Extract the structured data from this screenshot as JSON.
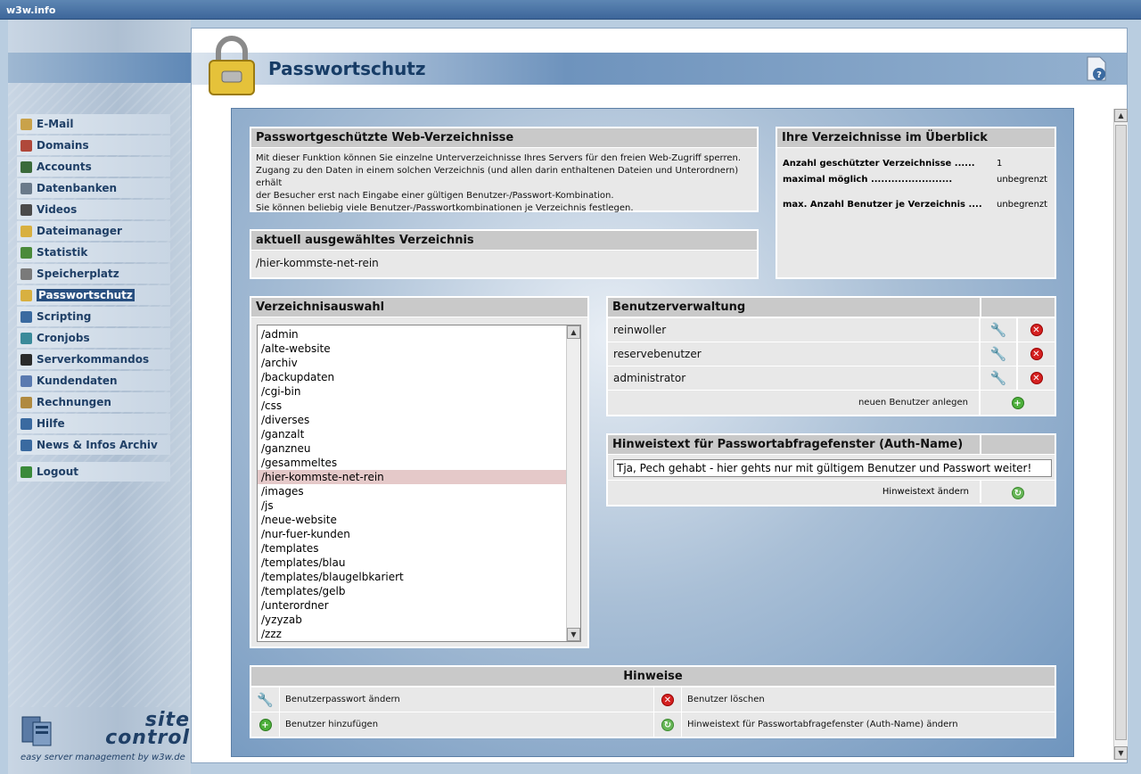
{
  "window": {
    "title": "w3w.info"
  },
  "header": {
    "title": "Passwortschutz"
  },
  "nav": {
    "items": [
      {
        "label": "E-Mail",
        "icon": "email-icon",
        "color": "#c9a24a"
      },
      {
        "label": "Domains",
        "icon": "domains-icon",
        "color": "#b0483a"
      },
      {
        "label": "Accounts",
        "icon": "accounts-icon",
        "color": "#3a6a3a"
      },
      {
        "label": "Datenbanken",
        "icon": "database-icon",
        "color": "#6a7a8a"
      },
      {
        "label": "Videos",
        "icon": "videos-icon",
        "color": "#4a4a4a"
      },
      {
        "label": "Dateimanager",
        "icon": "folder-icon",
        "color": "#d8b040"
      },
      {
        "label": "Statistik",
        "icon": "statistics-icon",
        "color": "#4a8a3a"
      },
      {
        "label": "Speicherplatz",
        "icon": "storage-icon",
        "color": "#7a7a7a"
      },
      {
        "label": "Passwortschutz",
        "icon": "lock-icon",
        "color": "#d8b040"
      },
      {
        "label": "Scripting",
        "icon": "scripting-icon",
        "color": "#3a6aa0"
      },
      {
        "label": "Cronjobs",
        "icon": "cronjobs-icon",
        "color": "#3a8a9a"
      },
      {
        "label": "Serverkommandos",
        "icon": "terminal-icon",
        "color": "#2a2a2a"
      },
      {
        "label": "Kundendaten",
        "icon": "customer-icon",
        "color": "#5a7ab0"
      },
      {
        "label": "Rechnungen",
        "icon": "invoices-icon",
        "color": "#b08a40"
      },
      {
        "label": "Hilfe",
        "icon": "help-icon",
        "color": "#3a6aa0"
      },
      {
        "label": "News & Infos Archiv",
        "icon": "info-icon",
        "color": "#3a6aa0"
      },
      {
        "label": "Logout",
        "icon": "logout-icon",
        "color": "#3a8a3a"
      }
    ]
  },
  "logo": {
    "line1": "site",
    "line2": "control",
    "tagline": "easy server management by w3w.de"
  },
  "intro": {
    "title": "Passwortgeschützte Web-Verzeichnisse",
    "lines": [
      "Mit dieser Funktion können Sie einzelne Unterverzeichnisse Ihres Servers für den freien Web-Zugriff sperren.",
      "Zugang zu den Daten in einem solchen Verzeichnis (und allen darin enthaltenen Dateien und Unterordnern) erhält",
      "der Besucher erst nach Eingabe einer gültigen Benutzer-/Passwort-Kombination.",
      "Sie können beliebig viele Benutzer-/Passwortkombinationen je Verzeichnis festlegen."
    ]
  },
  "overview": {
    "title": "Ihre Verzeichnisse im Überblick",
    "rows": [
      {
        "key": "Anzahl geschützter Verzeichnisse ......",
        "value": "1"
      },
      {
        "key": "maximal möglich ........................",
        "value": "unbegrenzt"
      },
      {
        "key": "max. Anzahl Benutzer je Verzeichnis ....",
        "value": "unbegrenzt"
      }
    ]
  },
  "current": {
    "title": "aktuell ausgewähltes Verzeichnis",
    "path": "/hier-kommste-net-rein"
  },
  "dirs": {
    "title": "Verzeichnisauswahl",
    "selected": "/hier-kommste-net-rein",
    "items": [
      "/admin",
      "/alte-website",
      "/archiv",
      "/backupdaten",
      "/cgi-bin",
      "/css",
      "/diverses",
      "/ganzalt",
      "/ganzneu",
      "/gesammeltes",
      "/hier-kommste-net-rein",
      "/images",
      "/js",
      "/neue-website",
      "/nur-fuer-kunden",
      "/templates",
      "/templates/blau",
      "/templates/blaugelbkariert",
      "/templates/gelb",
      "/unterordner",
      "/yzyzab",
      "/zzz"
    ]
  },
  "users": {
    "title": "Benutzerverwaltung",
    "items": [
      "reinwoller",
      "reservebenutzer",
      "administrator"
    ],
    "add_label": "neuen Benutzer anlegen"
  },
  "authname": {
    "title": "Hinweistext für Passwortabfragefenster (Auth-Name)",
    "value": "Tja, Pech gehabt - hier gehts nur mit gültigem Benutzer und Passwort weiter!",
    "change_label": "Hinweistext ändern"
  },
  "hints": {
    "title": "Hinweise",
    "edit": "Benutzerpasswort ändern",
    "delete": "Benutzer löschen",
    "add": "Benutzer hinzufügen",
    "change": "Hinweistext für Passwortabfragefenster (Auth-Name) ändern"
  }
}
